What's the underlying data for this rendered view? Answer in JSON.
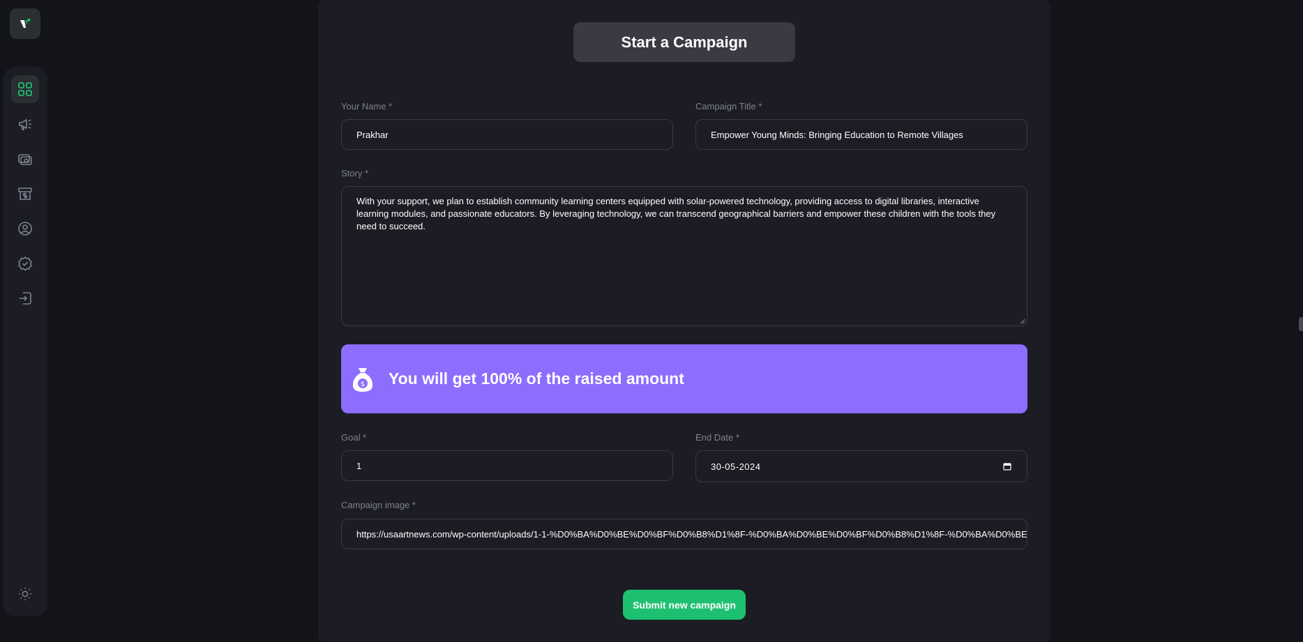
{
  "brand": {
    "logo_icon": "logo-icon"
  },
  "sidebar": {
    "items": [
      {
        "name": "dashboard",
        "icon": "grid-icon",
        "active": true
      },
      {
        "name": "campaign",
        "icon": "megaphone-icon",
        "active": false
      },
      {
        "name": "payment",
        "icon": "payment-icon",
        "active": false
      },
      {
        "name": "withdraw",
        "icon": "withdraw-icon",
        "active": false
      },
      {
        "name": "profile",
        "icon": "user-icon",
        "active": false
      },
      {
        "name": "verified",
        "icon": "badge-check-icon",
        "active": false
      },
      {
        "name": "logout",
        "icon": "logout-icon",
        "active": false
      }
    ],
    "theme_icon": "sun-icon"
  },
  "form": {
    "header": "Start a Campaign",
    "name_label": "Your Name *",
    "name_value": "Prakhar",
    "title_label": "Campaign Title *",
    "title_value": "Empower Young Minds: Bringing Education to Remote Villages",
    "story_label": "Story *",
    "story_value": "With your support, we plan to establish community learning centers equipped with solar-powered technology, providing access to digital libraries, interactive learning modules, and passionate educators. By leveraging technology, we can transcend geographical barriers and empower these children with the tools they need to succeed.",
    "banner_text": "You will get 100% of the raised amount",
    "goal_label": "Goal *",
    "goal_value": "1",
    "end_date_label": "End Date *",
    "end_date_value": "30-05-2024",
    "image_label": "Campaign image *",
    "image_value": "https://usaartnews.com/wp-content/uploads/1-1-%D0%BA%D0%BE%D0%BF%D0%B8%D1%8F-%D0%BA%D0%BE%D0%BF%D0%B8%D1%8F-%D0%BA%D0%BE%D0%BF%D0%B8%D1%8F-2-1024x",
    "submit_label": "Submit new campaign"
  },
  "colors": {
    "accent": "#1dc071",
    "banner": "#8c6dfd",
    "background": "#13131a",
    "panel": "#1c1c24"
  }
}
